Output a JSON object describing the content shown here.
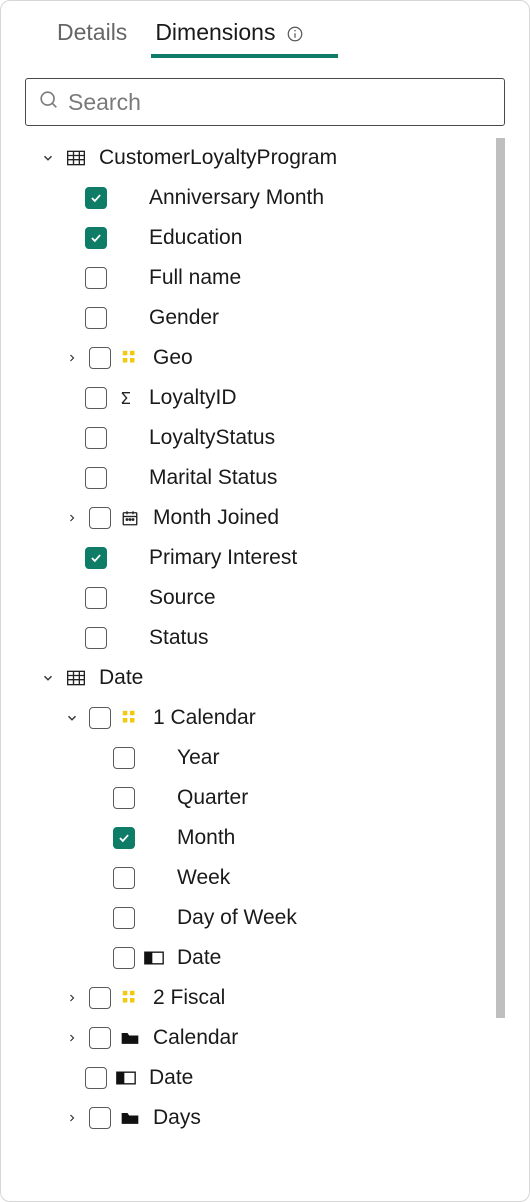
{
  "colors": {
    "accent": "#0e7c66"
  },
  "tabs": {
    "details": "Details",
    "dimensions": "Dimensions"
  },
  "search": {
    "placeholder": "Search"
  },
  "tree": {
    "g0": {
      "label": "CustomerLoyaltyProgram"
    },
    "g0_i0": {
      "label": "Anniversary Month"
    },
    "g0_i1": {
      "label": "Education"
    },
    "g0_i2": {
      "label": "Full name"
    },
    "g0_i3": {
      "label": "Gender"
    },
    "g0_i4": {
      "label": "Geo"
    },
    "g0_i5": {
      "label": "LoyaltyID"
    },
    "g0_i6": {
      "label": "LoyaltyStatus"
    },
    "g0_i7": {
      "label": "Marital Status"
    },
    "g0_i8": {
      "label": "Month Joined"
    },
    "g0_i9": {
      "label": "Primary Interest"
    },
    "g0_i10": {
      "label": "Source"
    },
    "g0_i11": {
      "label": "Status"
    },
    "g1": {
      "label": "Date"
    },
    "g1_i0": {
      "label": "1 Calendar"
    },
    "g1_i0_c0": {
      "label": "Year"
    },
    "g1_i0_c1": {
      "label": "Quarter"
    },
    "g1_i0_c2": {
      "label": "Month"
    },
    "g1_i0_c3": {
      "label": "Week"
    },
    "g1_i0_c4": {
      "label": "Day of Week"
    },
    "g1_i0_c5": {
      "label": "Date"
    },
    "g1_i1": {
      "label": "2 Fiscal"
    },
    "g1_i2": {
      "label": "Calendar"
    },
    "g1_i3": {
      "label": "Date"
    },
    "g1_i4": {
      "label": "Days"
    }
  }
}
